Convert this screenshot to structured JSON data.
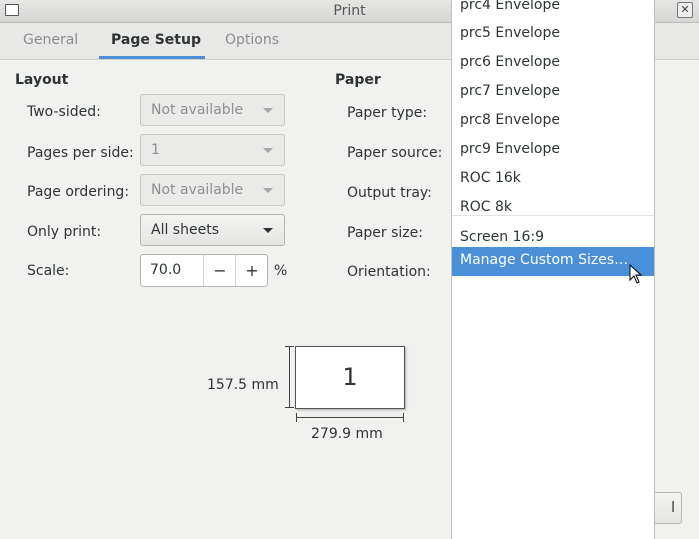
{
  "window": {
    "title": "Print"
  },
  "tabs": [
    {
      "label": "General"
    },
    {
      "label": "Page Setup"
    },
    {
      "label": "Options"
    }
  ],
  "layout": {
    "title": "Layout",
    "two_sided": {
      "label": "Two-sided:",
      "value": "Not available"
    },
    "pages_per_side": {
      "label": "Pages per side:",
      "value": "1"
    },
    "page_ordering": {
      "label": "Page ordering:",
      "value": "Not available"
    },
    "only_print": {
      "label": "Only print:",
      "value": "All sheets"
    },
    "scale": {
      "label": "Scale:",
      "value": "70.0",
      "minus": "−",
      "plus": "+",
      "unit": "%"
    }
  },
  "paper": {
    "title": "Paper",
    "paper_type": {
      "label": "Paper type:"
    },
    "paper_source": {
      "label": "Paper source:"
    },
    "output_tray": {
      "label": "Output tray:"
    },
    "paper_size": {
      "label": "Paper size:"
    },
    "orientation": {
      "label": "Orientation:"
    }
  },
  "preview": {
    "page_number": "1",
    "height_label": "157.5 mm",
    "width_label": "279.9 mm"
  },
  "paper_size_menu": {
    "items": [
      "prc4 Envelope",
      "prc5 Envelope",
      "prc6 Envelope",
      "prc7 Envelope",
      "prc8 Envelope",
      "prc9 Envelope",
      "ROC 16k",
      "ROC 8k",
      "Screen 16:9",
      "Manage Custom Sizes…"
    ],
    "selected": "Manage Custom Sizes…"
  },
  "footer": {
    "peek_button_text": "l"
  },
  "colors": {
    "accent": "#4a90d9",
    "background": "#f1f1f0"
  }
}
